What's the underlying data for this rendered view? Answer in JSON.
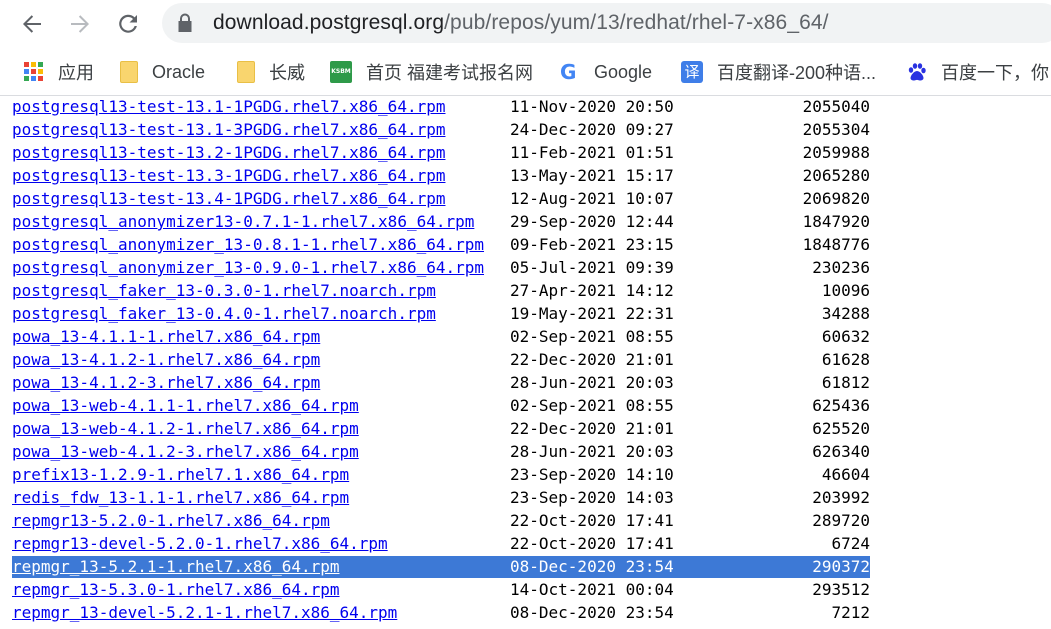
{
  "browser": {
    "url_host": "download.postgresql.org",
    "url_path": "/pub/repos/yum/13/redhat/rhel-7-x86_64/"
  },
  "bookmarks": [
    {
      "label": "应用",
      "icon": "apps-grid-icon"
    },
    {
      "label": "Oracle",
      "icon": "folder-icon"
    },
    {
      "label": "长威",
      "icon": "folder-icon"
    },
    {
      "label": "首页 福建考试报名网",
      "icon": "ksbm-site-icon"
    },
    {
      "label": "Google",
      "icon": "google-icon"
    },
    {
      "label": "百度翻译-200种语...",
      "icon": "baidu-fanyi-icon"
    },
    {
      "label": "百度一下，你",
      "icon": "baidu-paw-icon"
    }
  ],
  "listing": {
    "selected_index": 20,
    "rows": [
      {
        "name": "postgresql13-test-13.1-1PGDG.rhel7.x86_64.rpm",
        "date": "11-Nov-2020 20:50",
        "size": "2055040"
      },
      {
        "name": "postgresql13-test-13.1-3PGDG.rhel7.x86_64.rpm",
        "date": "24-Dec-2020 09:27",
        "size": "2055304"
      },
      {
        "name": "postgresql13-test-13.2-1PGDG.rhel7.x86_64.rpm",
        "date": "11-Feb-2021 01:51",
        "size": "2059988"
      },
      {
        "name": "postgresql13-test-13.3-1PGDG.rhel7.x86_64.rpm",
        "date": "13-May-2021 15:17",
        "size": "2065280"
      },
      {
        "name": "postgresql13-test-13.4-1PGDG.rhel7.x86_64.rpm",
        "date": "12-Aug-2021 10:07",
        "size": "2069820"
      },
      {
        "name": "postgresql_anonymizer13-0.7.1-1.rhel7.x86_64.rpm",
        "date": "29-Sep-2020 12:44",
        "size": "1847920"
      },
      {
        "name": "postgresql_anonymizer_13-0.8.1-1.rhel7.x86_64.rpm",
        "date": "09-Feb-2021 23:15",
        "size": "1848776"
      },
      {
        "name": "postgresql_anonymizer_13-0.9.0-1.rhel7.x86_64.rpm",
        "date": "05-Jul-2021 09:39",
        "size": "230236"
      },
      {
        "name": "postgresql_faker_13-0.3.0-1.rhel7.noarch.rpm",
        "date": "27-Apr-2021 14:12",
        "size": "10096"
      },
      {
        "name": "postgresql_faker_13-0.4.0-1.rhel7.noarch.rpm",
        "date": "19-May-2021 22:31",
        "size": "34288"
      },
      {
        "name": "powa_13-4.1.1-1.rhel7.x86_64.rpm",
        "date": "02-Sep-2021 08:55",
        "size": "60632"
      },
      {
        "name": "powa_13-4.1.2-1.rhel7.x86_64.rpm",
        "date": "22-Dec-2020 21:01",
        "size": "61628"
      },
      {
        "name": "powa_13-4.1.2-3.rhel7.x86_64.rpm",
        "date": "28-Jun-2021 20:03",
        "size": "61812"
      },
      {
        "name": "powa_13-web-4.1.1-1.rhel7.x86_64.rpm",
        "date": "02-Sep-2021 08:55",
        "size": "625436"
      },
      {
        "name": "powa_13-web-4.1.2-1.rhel7.x86_64.rpm",
        "date": "22-Dec-2020 21:01",
        "size": "625520"
      },
      {
        "name": "powa_13-web-4.1.2-3.rhel7.x86_64.rpm",
        "date": "28-Jun-2021 20:03",
        "size": "626340"
      },
      {
        "name": "prefix13-1.2.9-1.rhel7.1.x86_64.rpm",
        "date": "23-Sep-2020 14:10",
        "size": "46604"
      },
      {
        "name": "redis_fdw_13-1.1-1.rhel7.x86_64.rpm",
        "date": "23-Sep-2020 14:03",
        "size": "203992"
      },
      {
        "name": "repmgr13-5.2.0-1.rhel7.x86_64.rpm",
        "date": "22-Oct-2020 17:41",
        "size": "289720"
      },
      {
        "name": "repmgr13-devel-5.2.0-1.rhel7.x86_64.rpm",
        "date": "22-Oct-2020 17:41",
        "size": "6724"
      },
      {
        "name": "repmgr_13-5.2.1-1.rhel7.x86_64.rpm",
        "date": "08-Dec-2020 23:54",
        "size": "290372"
      },
      {
        "name": "repmgr_13-5.3.0-1.rhel7.x86_64.rpm",
        "date": "14-Oct-2021 00:04",
        "size": "293512"
      },
      {
        "name": "repmgr_13-devel-5.2.1-1.rhel7.x86_64.rpm",
        "date": "08-Dec-2020 23:54",
        "size": "7212"
      }
    ]
  },
  "colors": {
    "link": "#0000ee",
    "selection": "#3d79d6",
    "omnibox_bg": "#f1f3f4"
  }
}
